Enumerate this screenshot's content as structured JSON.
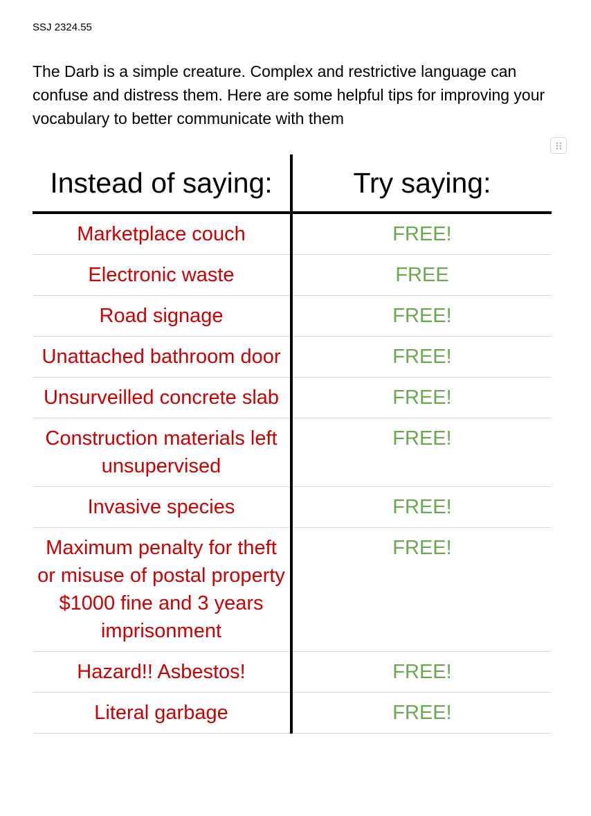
{
  "document": {
    "id_label": "SSJ 2324.55",
    "intro": "The Darb is a simple creature. Complex and restrictive language can confuse and distress them. Here are some helpful tips for improving your vocabulary to better communicate with them"
  },
  "table": {
    "headers": [
      "Instead of saying:",
      "Try saying:"
    ],
    "rows": [
      [
        "Marketplace couch",
        "FREE!"
      ],
      [
        "Electronic waste",
        "FREE"
      ],
      [
        "Road signage",
        "FREE!"
      ],
      [
        "Unattached bathroom door",
        "FREE!"
      ],
      [
        "Unsurveilled concrete slab",
        "FREE!"
      ],
      [
        "Construction materials left unsupervised",
        "FREE!"
      ],
      [
        "Invasive species",
        "FREE!"
      ],
      [
        "Maximum penalty for theft or misuse of postal property $1000 fine and 3 years imprisonment",
        "FREE!"
      ],
      [
        "Hazard!! Asbestos!",
        "FREE!"
      ],
      [
        "Literal garbage",
        "FREE!"
      ]
    ],
    "colors": {
      "left_text": "#cc0000",
      "right_text": "#6aa84f"
    },
    "handle_icon": "drag-handle-icon"
  }
}
